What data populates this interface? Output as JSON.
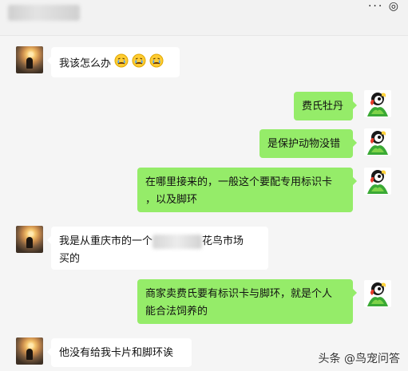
{
  "header": {
    "title": "",
    "icons": "··· ◎"
  },
  "messages": [
    {
      "side": "left",
      "text": "我该怎么办",
      "emoji_count": 3
    },
    {
      "side": "right",
      "text": "费氏牡丹"
    },
    {
      "side": "right",
      "text": "是保护动物没错"
    },
    {
      "side": "right",
      "line1": "在哪里接来的，一般这个要配专用标识卡",
      "line2": "，以及脚环"
    },
    {
      "side": "left",
      "part1": "我是从重庆市的一个",
      "part2": "花鸟市场",
      "line2": "买的"
    },
    {
      "side": "right",
      "line1": "商家卖费氏要有标识卡与脚环，就是个人",
      "line2": "能合法饲养的"
    },
    {
      "side": "left",
      "text": "他没有给我卡片和脚环诶"
    }
  ],
  "watermark": "头条 @鸟宠问答",
  "colors": {
    "incoming": "#ffffff",
    "outgoing": "#95ec69",
    "background": "#f5f5f5"
  },
  "icons": {
    "emoji": "crying-face-icon",
    "parrot": "parrot-avatar-icon"
  }
}
